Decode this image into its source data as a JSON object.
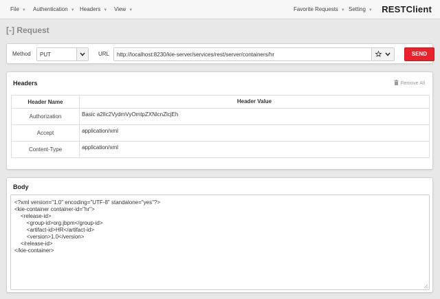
{
  "navbar": {
    "left_menus": [
      {
        "label": "File"
      },
      {
        "label": "Authentication"
      },
      {
        "label": "Headers"
      },
      {
        "label": "View"
      }
    ],
    "right_menus": [
      {
        "label": "Favorite Requests"
      },
      {
        "label": "Setting"
      }
    ],
    "brand": "RESTClient"
  },
  "request": {
    "section_title": "[-] Request",
    "method_label": "Method",
    "method_value": "PUT",
    "url_label": "URL",
    "url_value": "http://localhost:8230/kie-server/services/rest/server/containers/hr",
    "send_label": "SEND"
  },
  "headers": {
    "title": "Headers",
    "remove_all_label": "Remove All",
    "columns": [
      "Header Name",
      "Header Value"
    ],
    "rows": [
      {
        "name": "Authorization",
        "value": "Basic a2lIc2VydmVyOmtpZXNlcnZlcjEh"
      },
      {
        "name": "Accept",
        "value": "application/xml"
      },
      {
        "name": "Content-Type",
        "value": "application/xml"
      }
    ]
  },
  "body": {
    "title": "Body",
    "lines": [
      "<?xml version=\"1.0\" encoding=\"UTF-8\" standalone=\"yes\"?>",
      "<kie-container container-id=\"hr\">",
      "    <release-id>",
      "        <group-id>org.jbpm</group-id>",
      "        <artifact-id>HR</artifact-id>",
      "        <version>1.0</version>",
      "    </release-id>",
      "</kie-container>"
    ]
  },
  "colors": {
    "send_button": "#e7232d",
    "section_title": "#8a8a8a",
    "page_background": "#e8e8e8"
  },
  "icons": {
    "menu_caret": "caret-down-icon",
    "favorite": "star-icon",
    "dropdown": "chevron-down-icon",
    "remove_all": "trash-icon",
    "resize": "resize-grip-icon"
  }
}
